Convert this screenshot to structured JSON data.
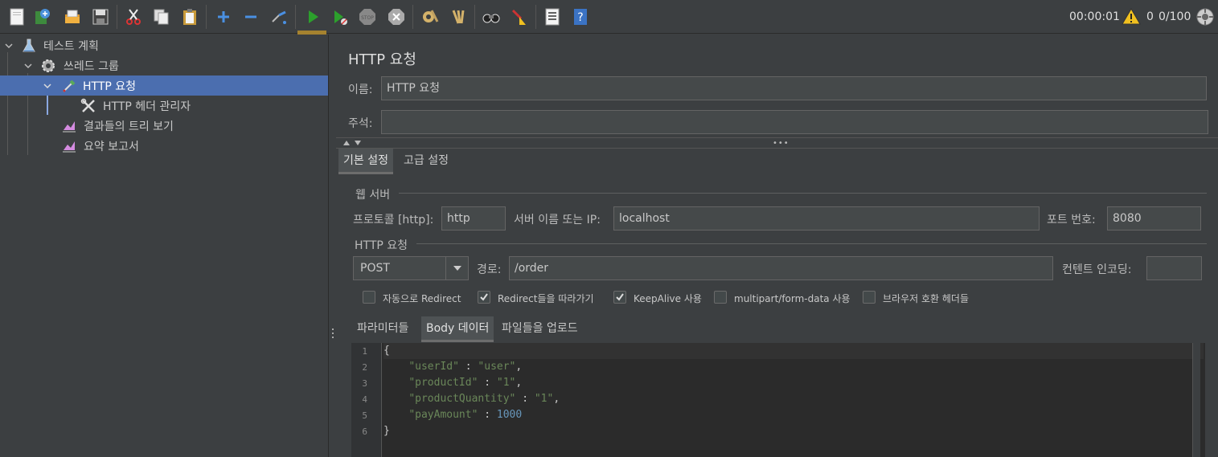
{
  "toolbar": {
    "buttons": [
      "new-icon",
      "templates-icon",
      "open-icon",
      "save-icon",
      "cut-icon",
      "copy-icon",
      "paste-icon",
      "expand-icon",
      "collapse-icon",
      "toggle-icon",
      "start-icon",
      "start-no-pause-icon",
      "stop-icon",
      "shutdown-icon",
      "clear-icon",
      "clear-all-icon",
      "search-icon",
      "reset-search-icon",
      "function-helper-icon",
      "help-icon"
    ],
    "timer": "00:00:01",
    "warnings": "0",
    "threads": "0/100"
  },
  "tree": {
    "items": [
      {
        "label": "테스트 계획",
        "icon": "flask-icon"
      },
      {
        "label": "쓰레드 그룹",
        "icon": "gear-icon"
      },
      {
        "label": "HTTP 요청",
        "icon": "pipette-icon"
      },
      {
        "label": "HTTP 헤더 관리자",
        "icon": "wrench-icon"
      },
      {
        "label": "결과들의 트리 보기",
        "icon": "graph-icon"
      },
      {
        "label": "요약 보고서",
        "icon": "graph-icon"
      }
    ]
  },
  "panel": {
    "title": "HTTP 요청",
    "name_label": "이름:",
    "name_value": "HTTP 요청",
    "comment_label": "주석:",
    "comment_value": ""
  },
  "tabs": {
    "basic": "기본 설정",
    "advanced": "고급 설정"
  },
  "web_server": {
    "group_title": "웹 서버",
    "protocol_label": "프로토콜 [http]:",
    "protocol_value": "http",
    "server_label": "서버 이름 또는 IP:",
    "server_value": "localhost",
    "port_label": "포트 번호:",
    "port_value": "8080"
  },
  "http_request": {
    "group_title": "HTTP 요청",
    "method": "POST",
    "path_label": "경로:",
    "path_value": "/order",
    "encoding_label": "컨텐트 인코딩:",
    "encoding_value": ""
  },
  "options": [
    {
      "label": "자동으로 Redirect",
      "checked": false
    },
    {
      "label": "Redirect들을 따라가기",
      "checked": true
    },
    {
      "label": "KeepAlive 사용",
      "checked": true
    },
    {
      "label": "multipart/form-data 사용",
      "checked": false
    },
    {
      "label": "브라우저 호환 헤더들",
      "checked": false
    }
  ],
  "sub_tabs": {
    "params": "파라미터들",
    "body": "Body 데이터",
    "files": "파일들을 업로드"
  },
  "editor": {
    "line_numbers": [
      "1",
      "2",
      "3",
      "4",
      "5",
      "6"
    ],
    "lines": {
      "l1": "{",
      "l2_key": "\"userId\"",
      "l2_sep": " : ",
      "l2_val": "\"user\"",
      "l2_end": ",",
      "l3_key": "\"productId\"",
      "l3_sep": " : ",
      "l3_val": "\"1\"",
      "l3_end": ",",
      "l4_key": "\"productQuantity\"",
      "l4_sep": " : ",
      "l4_val": "\"1\"",
      "l4_end": ",",
      "l5_key": "\"payAmount\"",
      "l5_sep": " : ",
      "l5_val": "1000",
      "l6": "}"
    }
  }
}
